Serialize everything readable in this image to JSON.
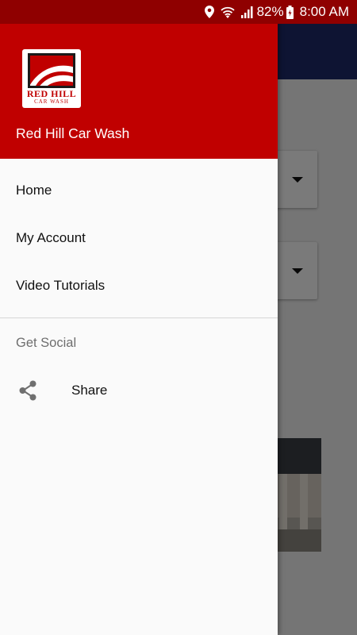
{
  "status_bar": {
    "battery_percent": "82%",
    "time": "8:00 AM",
    "icons": [
      "location-icon",
      "wifi-icon",
      "signal-icon",
      "battery-icon"
    ]
  },
  "drawer": {
    "app_name": "Red Hill Car Wash",
    "logo": {
      "line1": "RED HILL",
      "line2": "CAR WASH"
    },
    "menu_items": [
      {
        "label": "Home"
      },
      {
        "label": "My Account"
      },
      {
        "label": "Video Tutorials"
      }
    ],
    "section_title": "Get Social",
    "share": {
      "label": "Share",
      "icon": "share-icon"
    }
  },
  "colors": {
    "header_red": "#c00000",
    "status_bar_red": "#8f0000",
    "toolbar_navy": "#1f2a6b"
  }
}
